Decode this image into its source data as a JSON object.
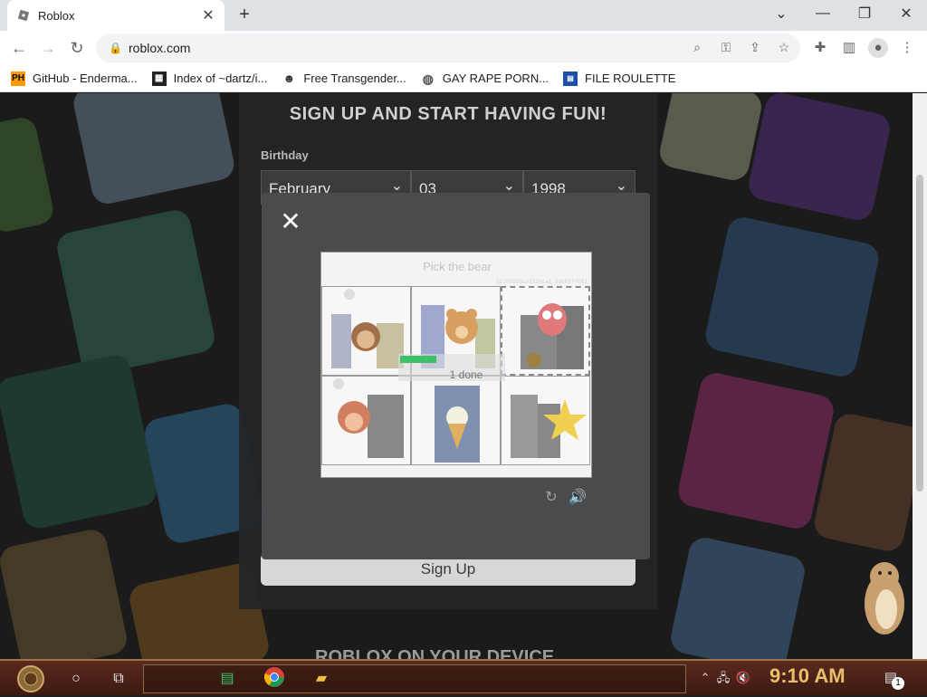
{
  "browser": {
    "tab_title": "Roblox",
    "url": "roblox.com",
    "bookmarks": [
      {
        "label": "GitHub - Enderma...",
        "icon": "ph-icon"
      },
      {
        "label": "Index of ~dartz/i...",
        "icon": "dartz-icon"
      },
      {
        "label": "Free Transgender...",
        "icon": "mask-icon"
      },
      {
        "label": "GAY RAPE PORN...",
        "icon": "globe-icon"
      },
      {
        "label": "FILE ROULETTE",
        "icon": "mft-icon"
      }
    ],
    "bookmark_ph_text": "PH"
  },
  "signup": {
    "title": "SIGN UP AND START HAVING FUN!",
    "birthday_label": "Birthday",
    "month": "February",
    "day": "03",
    "year": "1998",
    "signup_button": "Sign Up",
    "device_text": "ROBLOX ON YOUR DEVICE"
  },
  "captcha": {
    "prompt": "Pick the bear",
    "code": "51107590c01516ca1_3860877001",
    "progress_text": "1 done",
    "progress_fraction": 0.35,
    "cells": [
      {
        "name": "monkey",
        "selected": false
      },
      {
        "name": "bear",
        "selected": false
      },
      {
        "name": "owl",
        "selected": true
      },
      {
        "name": "monkey",
        "selected": false
      },
      {
        "name": "icecream",
        "selected": false
      },
      {
        "name": "star",
        "selected": false
      }
    ]
  },
  "taskbar": {
    "clock": "9:10 AM",
    "notification_count": "1"
  },
  "colors": {
    "accent_green": "#3cc06a",
    "clock_color": "#e8c06a",
    "taskbar_bg": "#4a2218"
  }
}
